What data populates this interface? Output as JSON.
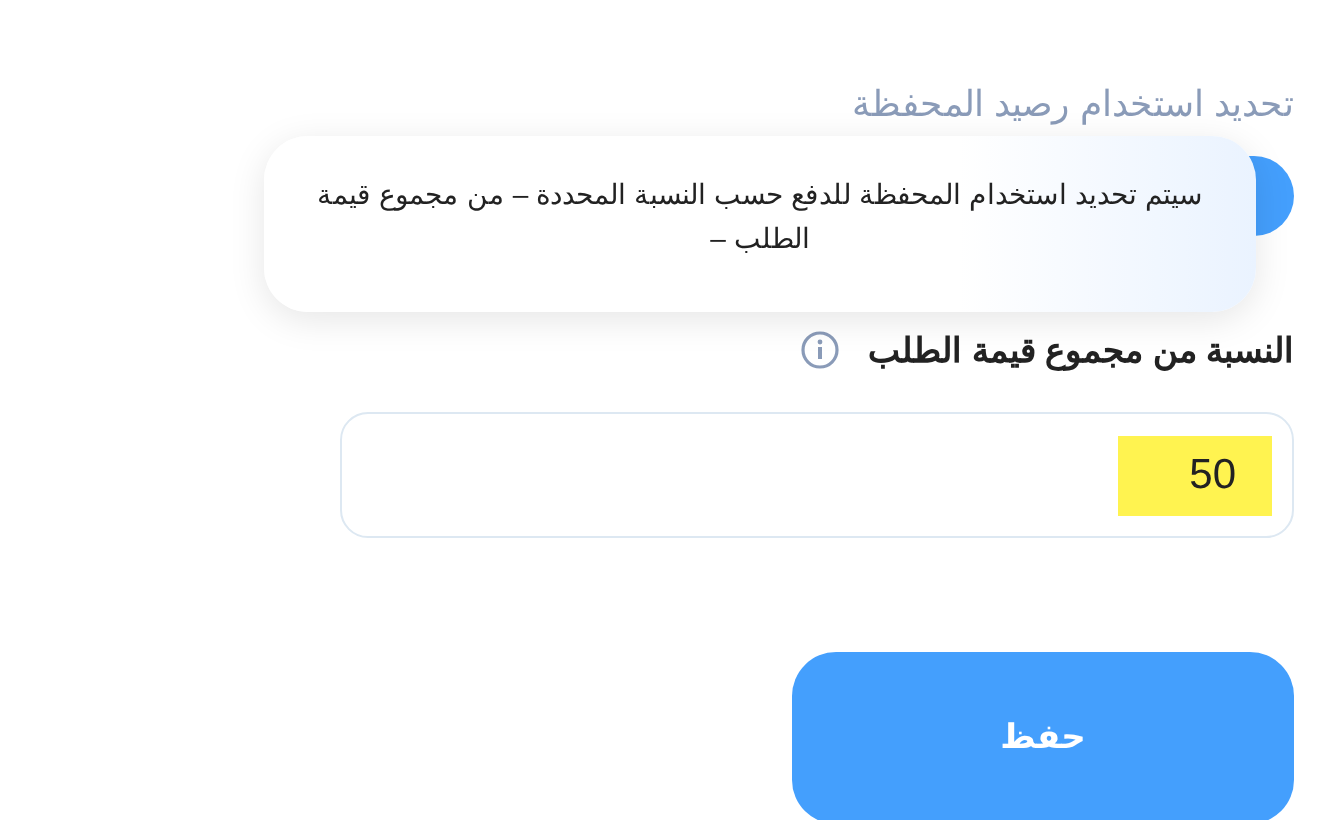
{
  "section": {
    "title": "تحديد استخدام رصيد المحفظة"
  },
  "toggle": {
    "on": true
  },
  "tooltip": {
    "text": "سيتم تحديد استخدام المحفظة للدفع حسب النسبة المحددة – من مجموع قيمة الطلب –"
  },
  "field": {
    "label": "النسبة من مجموع قيمة الطلب",
    "value": "50",
    "highlighted": true
  },
  "buttons": [
    {
      "label": "حفظ"
    }
  ]
}
